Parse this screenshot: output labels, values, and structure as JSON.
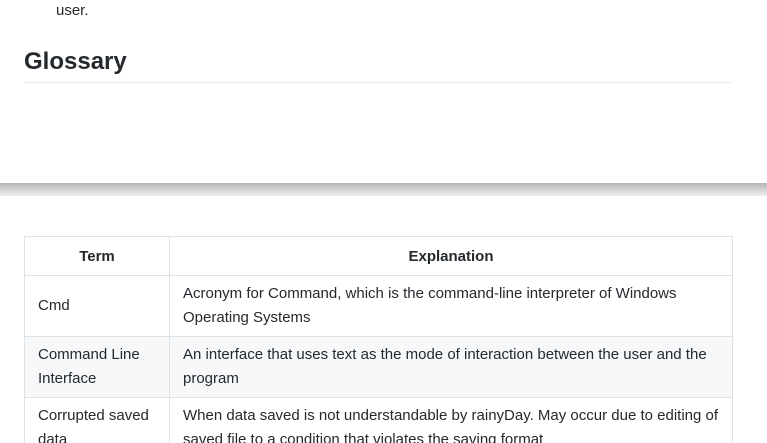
{
  "prev_text": "user.",
  "heading": "Glossary",
  "table": {
    "headers": {
      "term": "Term",
      "explanation": "Explanation"
    },
    "rows": [
      {
        "term": "Cmd",
        "explanation": "Acronym for Command, which is the command-line interpreter of Windows Operating Systems"
      },
      {
        "term": "Command Line Interface",
        "explanation": "An interface that uses text as the mode of interaction between the user and the program"
      },
      {
        "term": "Corrupted saved data",
        "explanation": "When data saved is not understandable by rainyDay. May occur due to editing of saved file to a condition that violates the saving format"
      }
    ]
  }
}
